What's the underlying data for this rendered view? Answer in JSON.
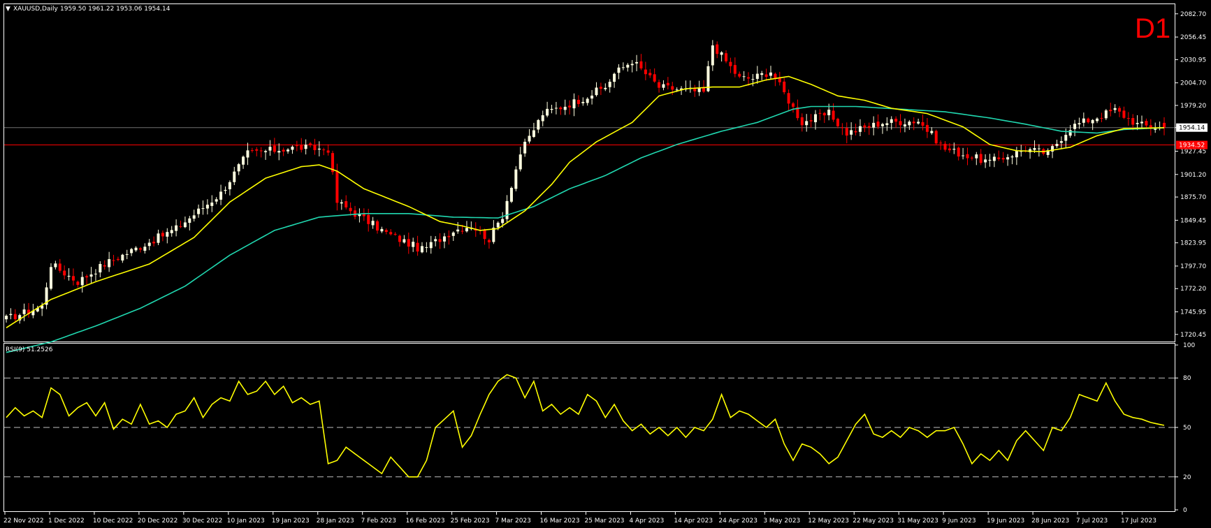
{
  "header": {
    "symbol": "XAUUSD,Daily",
    "ohlc": "1959.50 1961.22 1953.06 1954.14",
    "timeframe_badge": "D1"
  },
  "rsi_panel": {
    "label": "RSI(9) 51.2526"
  },
  "colors": {
    "background": "#000000",
    "bull_candle": "#ffffe0",
    "bear_candle": "#ff0000",
    "ma_fast": "#ffff00",
    "ma_slow": "#20d8b0",
    "rsi_line": "#ffff00",
    "price_line": "#707070",
    "support_line": "#ff0000",
    "grid_frame": "#ffffff"
  },
  "chart_data": [
    {
      "type": "candlestick",
      "title": "XAUUSD,Daily",
      "ylim": [
        1714,
        2092
      ],
      "y_ticks": [
        "2082.70",
        "2056.45",
        "2030.95",
        "2004.70",
        "1979.20",
        "1954.14",
        "1927.45",
        "1901.20",
        "1875.70",
        "1849.45",
        "1823.95",
        "1797.70",
        "1772.20",
        "1745.95",
        "1720.45"
      ],
      "x_ticks": [
        "22 Nov 2022",
        "1 Dec 2022",
        "10 Dec 2022",
        "20 Dec 2022",
        "30 Dec 2022",
        "10 Jan 2023",
        "19 Jan 2023",
        "28 Jan 2023",
        "7 Feb 2023",
        "16 Feb 2023",
        "25 Feb 2023",
        "7 Mar 2023",
        "16 Mar 2023",
        "25 Mar 2023",
        "4 Apr 2023",
        "14 Apr 2023",
        "24 Apr 2023",
        "3 May 2023",
        "12 May 2023",
        "22 May 2023",
        "31 May 2023",
        "9 Jun 2023",
        "19 Jun 2023",
        "28 Jun 2023",
        "7 Jul 2023",
        "17 Jul 2023"
      ],
      "current_price": {
        "value": 1954.14,
        "label": "1954.14"
      },
      "support_level": {
        "value": 1934.52,
        "label": "1934.52"
      },
      "close_anchors": [
        [
          0,
          1738
        ],
        [
          8,
          1752
        ],
        [
          10,
          1800
        ],
        [
          16,
          1780
        ],
        [
          22,
          1800
        ],
        [
          30,
          1820
        ],
        [
          38,
          1840
        ],
        [
          48,
          1880
        ],
        [
          54,
          1925
        ],
        [
          65,
          1932
        ],
        [
          70,
          1930
        ],
        [
          72,
          1930
        ],
        [
          74,
          1870
        ],
        [
          85,
          1835
        ],
        [
          93,
          1816
        ],
        [
          100,
          1838
        ],
        [
          104,
          1844
        ],
        [
          108,
          1828
        ],
        [
          111,
          1855
        ],
        [
          115,
          1925
        ],
        [
          120,
          1970
        ],
        [
          128,
          1985
        ],
        [
          134,
          2000
        ],
        [
          136,
          2015
        ],
        [
          140,
          2030
        ],
        [
          146,
          2000
        ],
        [
          156,
          1994
        ],
        [
          158,
          2048
        ],
        [
          164,
          2010
        ],
        [
          167,
          2010
        ],
        [
          171,
          2018
        ],
        [
          178,
          1960
        ],
        [
          184,
          1970
        ],
        [
          188,
          1948
        ],
        [
          196,
          1960
        ],
        [
          204,
          1962
        ],
        [
          210,
          1930
        ],
        [
          220,
          1915
        ],
        [
          228,
          1930
        ],
        [
          233,
          1925
        ],
        [
          238,
          1955
        ],
        [
          248,
          1974
        ],
        [
          253,
          1958
        ],
        [
          256,
          1955
        ],
        [
          259,
          1954.14
        ]
      ],
      "ma_fast_anchors": [
        [
          0,
          1728
        ],
        [
          10,
          1760
        ],
        [
          20,
          1780
        ],
        [
          32,
          1800
        ],
        [
          42,
          1830
        ],
        [
          50,
          1870
        ],
        [
          58,
          1897
        ],
        [
          66,
          1910
        ],
        [
          70,
          1912
        ],
        [
          74,
          1905
        ],
        [
          80,
          1885
        ],
        [
          90,
          1865
        ],
        [
          97,
          1848
        ],
        [
          102,
          1843
        ],
        [
          106,
          1838
        ],
        [
          110,
          1840
        ],
        [
          116,
          1860
        ],
        [
          122,
          1890
        ],
        [
          126,
          1915
        ],
        [
          132,
          1938
        ],
        [
          140,
          1960
        ],
        [
          146,
          1990
        ],
        [
          152,
          1998
        ],
        [
          158,
          2000
        ],
        [
          164,
          2000
        ],
        [
          170,
          2008
        ],
        [
          175,
          2012
        ],
        [
          180,
          2003
        ],
        [
          186,
          1990
        ],
        [
          192,
          1985
        ],
        [
          198,
          1976
        ],
        [
          206,
          1970
        ],
        [
          214,
          1955
        ],
        [
          220,
          1935
        ],
        [
          226,
          1928
        ],
        [
          232,
          1927
        ],
        [
          238,
          1932
        ],
        [
          244,
          1945
        ],
        [
          250,
          1953
        ],
        [
          259,
          1954
        ]
      ],
      "ma_slow_anchors": [
        [
          0,
          1700
        ],
        [
          10,
          1712
        ],
        [
          20,
          1730
        ],
        [
          30,
          1750
        ],
        [
          40,
          1775
        ],
        [
          50,
          1810
        ],
        [
          60,
          1838
        ],
        [
          70,
          1853
        ],
        [
          80,
          1857
        ],
        [
          90,
          1857
        ],
        [
          100,
          1853
        ],
        [
          110,
          1852
        ],
        [
          118,
          1865
        ],
        [
          126,
          1885
        ],
        [
          134,
          1900
        ],
        [
          142,
          1920
        ],
        [
          150,
          1935
        ],
        [
          160,
          1950
        ],
        [
          168,
          1960
        ],
        [
          176,
          1975
        ],
        [
          180,
          1978
        ],
        [
          190,
          1978
        ],
        [
          200,
          1975
        ],
        [
          210,
          1972
        ],
        [
          220,
          1965
        ],
        [
          228,
          1958
        ],
        [
          236,
          1950
        ],
        [
          244,
          1948
        ],
        [
          250,
          1952
        ],
        [
          259,
          1954
        ]
      ]
    },
    {
      "type": "line",
      "title": "RSI(9) 51.2526",
      "ylim": [
        0,
        100
      ],
      "y_ticks": [
        "100",
        "80",
        "50",
        "20",
        "0"
      ],
      "levels": [
        80,
        50,
        20
      ],
      "value_anchors": [
        [
          0,
          56
        ],
        [
          2,
          62
        ],
        [
          4,
          57
        ],
        [
          6,
          60
        ],
        [
          8,
          56
        ],
        [
          10,
          74
        ],
        [
          12,
          70
        ],
        [
          14,
          57
        ],
        [
          16,
          62
        ],
        [
          18,
          65
        ],
        [
          20,
          57
        ],
        [
          22,
          65
        ],
        [
          24,
          49
        ],
        [
          26,
          55
        ],
        [
          28,
          52
        ],
        [
          30,
          64
        ],
        [
          32,
          52
        ],
        [
          34,
          54
        ],
        [
          36,
          50
        ],
        [
          38,
          58
        ],
        [
          40,
          60
        ],
        [
          42,
          68
        ],
        [
          44,
          56
        ],
        [
          46,
          64
        ],
        [
          48,
          68
        ],
        [
          50,
          66
        ],
        [
          52,
          78
        ],
        [
          54,
          70
        ],
        [
          56,
          72
        ],
        [
          58,
          78
        ],
        [
          60,
          70
        ],
        [
          62,
          75
        ],
        [
          64,
          65
        ],
        [
          66,
          68
        ],
        [
          68,
          64
        ],
        [
          70,
          66
        ],
        [
          72,
          28
        ],
        [
          74,
          30
        ],
        [
          76,
          38
        ],
        [
          78,
          34
        ],
        [
          80,
          30
        ],
        [
          82,
          26
        ],
        [
          84,
          22
        ],
        [
          86,
          32
        ],
        [
          88,
          26
        ],
        [
          90,
          20
        ],
        [
          92,
          20
        ],
        [
          94,
          30
        ],
        [
          96,
          50
        ],
        [
          98,
          55
        ],
        [
          100,
          60
        ],
        [
          102,
          38
        ],
        [
          104,
          45
        ],
        [
          106,
          58
        ],
        [
          108,
          70
        ],
        [
          110,
          78
        ],
        [
          112,
          82
        ],
        [
          114,
          80
        ],
        [
          116,
          68
        ],
        [
          118,
          78
        ],
        [
          120,
          60
        ],
        [
          122,
          64
        ],
        [
          124,
          58
        ],
        [
          126,
          62
        ],
        [
          128,
          58
        ],
        [
          130,
          70
        ],
        [
          132,
          66
        ],
        [
          134,
          56
        ],
        [
          136,
          64
        ],
        [
          138,
          54
        ],
        [
          140,
          48
        ],
        [
          142,
          52
        ],
        [
          144,
          46
        ],
        [
          146,
          50
        ],
        [
          148,
          45
        ],
        [
          150,
          50
        ],
        [
          152,
          44
        ],
        [
          154,
          50
        ],
        [
          156,
          48
        ],
        [
          158,
          55
        ],
        [
          160,
          70
        ],
        [
          162,
          56
        ],
        [
          164,
          60
        ],
        [
          166,
          58
        ],
        [
          168,
          54
        ],
        [
          170,
          50
        ],
        [
          172,
          55
        ],
        [
          174,
          40
        ],
        [
          176,
          30
        ],
        [
          178,
          40
        ],
        [
          180,
          38
        ],
        [
          182,
          34
        ],
        [
          184,
          28
        ],
        [
          186,
          32
        ],
        [
          188,
          42
        ],
        [
          190,
          52
        ],
        [
          192,
          58
        ],
        [
          194,
          46
        ],
        [
          196,
          44
        ],
        [
          198,
          48
        ],
        [
          200,
          44
        ],
        [
          202,
          50
        ],
        [
          204,
          48
        ],
        [
          206,
          44
        ],
        [
          208,
          48
        ],
        [
          210,
          48
        ],
        [
          212,
          50
        ],
        [
          214,
          40
        ],
        [
          216,
          28
        ],
        [
          218,
          34
        ],
        [
          220,
          30
        ],
        [
          222,
          36
        ],
        [
          224,
          30
        ],
        [
          226,
          42
        ],
        [
          228,
          48
        ],
        [
          230,
          42
        ],
        [
          232,
          36
        ],
        [
          234,
          50
        ],
        [
          236,
          48
        ],
        [
          238,
          56
        ],
        [
          240,
          70
        ],
        [
          242,
          68
        ],
        [
          244,
          66
        ],
        [
          246,
          77
        ],
        [
          248,
          66
        ],
        [
          250,
          58
        ],
        [
          252,
          56
        ],
        [
          254,
          55
        ],
        [
          256,
          53
        ],
        [
          259,
          51.2526
        ]
      ]
    }
  ]
}
